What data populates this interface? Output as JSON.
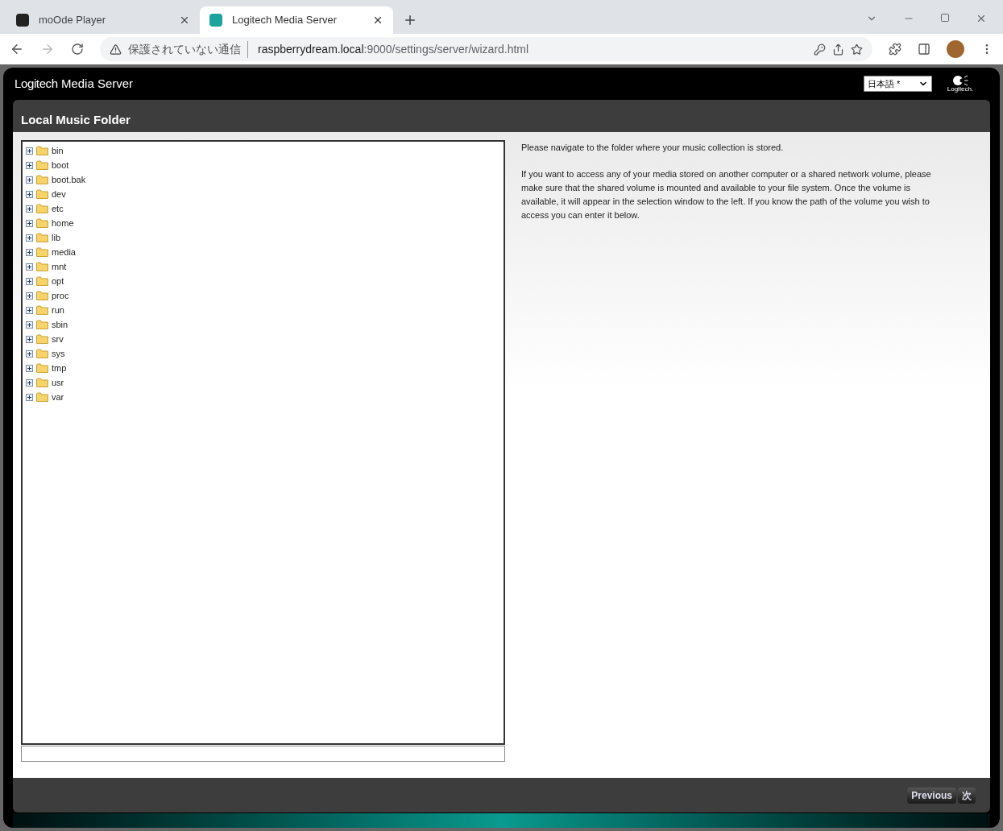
{
  "browser": {
    "tabs": [
      {
        "title": "moOde Player",
        "selected": false
      },
      {
        "title": "Logitech Media Server",
        "selected": true
      }
    ],
    "security": "保護されていない通信",
    "url_host": "raspberrydream.local",
    "url_path": ":9000/settings/server/wizard.html"
  },
  "header": {
    "brand": "Logitech",
    "product": "Media Server",
    "language": "日本語 *",
    "logo_text": "Logitech."
  },
  "section": {
    "title": "Local Music Folder"
  },
  "tree": [
    {
      "name": "bin",
      "expanded": false
    },
    {
      "name": "boot",
      "expanded": false
    },
    {
      "name": "boot.bak",
      "expanded": false
    },
    {
      "name": "dev",
      "expanded": false
    },
    {
      "name": "etc",
      "expanded": false
    },
    {
      "name": "home",
      "expanded": false
    },
    {
      "name": "lib",
      "expanded": false
    },
    {
      "name": "media",
      "expanded": false
    },
    {
      "name": "mnt",
      "expanded": false
    },
    {
      "name": "opt",
      "expanded": false
    },
    {
      "name": "proc",
      "expanded": false
    },
    {
      "name": "run",
      "expanded": false
    },
    {
      "name": "sbin",
      "expanded": false
    },
    {
      "name": "srv",
      "expanded": false
    },
    {
      "name": "sys",
      "expanded": false
    },
    {
      "name": "tmp",
      "expanded": false
    },
    {
      "name": "usr",
      "expanded": false
    },
    {
      "name": "var",
      "expanded": false
    }
  ],
  "instructions": [
    "Please navigate to the folder where your music collection is stored.",
    "If you want to access any of your media stored on another computer or a shared network volume, please make sure that the shared volume is mounted and available to your file system. Once the volume is available, it will appear in the selection window to the left. If you know the path of the volume you wish to access you can enter it below."
  ],
  "footer": {
    "buttons": [
      "Previous",
      "次"
    ]
  }
}
